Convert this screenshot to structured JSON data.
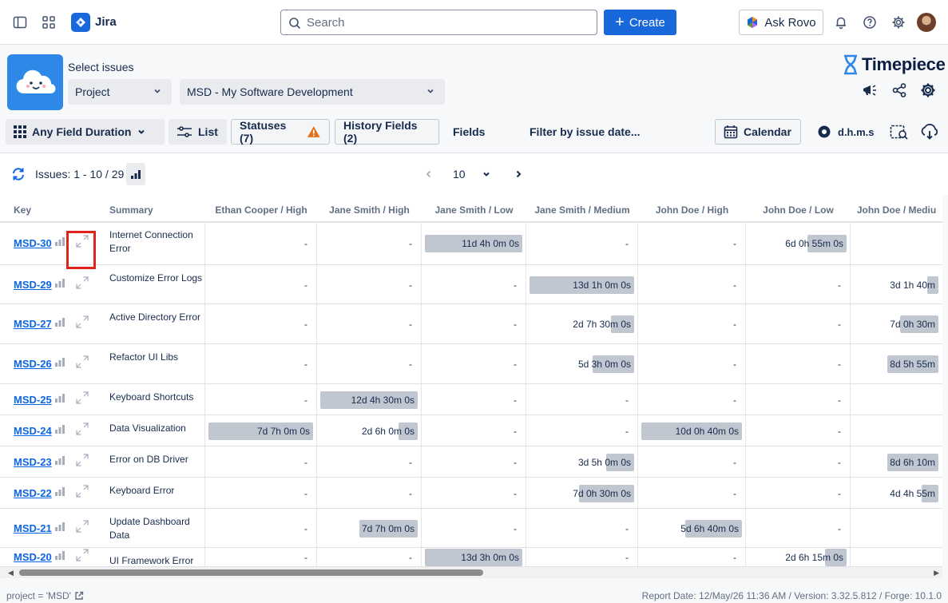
{
  "topbar": {
    "app_name": "Jira",
    "search_placeholder": "Search",
    "create_label": "Create",
    "rovo_label": "Ask Rovo"
  },
  "selector": {
    "label": "Select issues",
    "type_value": "Project",
    "project_value": "MSD - My Software Development"
  },
  "brand": {
    "name": "Timepiece"
  },
  "toolbar": {
    "report_type": "Any Field Duration",
    "list": "List",
    "statuses": "Statuses (7)",
    "history_fields": "History Fields (2)",
    "fields": "Fields",
    "filter_date": "Filter by issue date...",
    "calendar": "Calendar",
    "format": "d.h.m.s"
  },
  "pager": {
    "issues_label": "Issues: 1 - 10 / 29",
    "page_size": "10"
  },
  "table": {
    "headers": [
      "Key",
      "Summary",
      "Ethan Cooper / High",
      "Jane Smith / High",
      "Jane Smith / Low",
      "Jane Smith / Medium",
      "John Doe / High",
      "John Doe / Low",
      "John Doe / Mediu"
    ],
    "rows": [
      {
        "key": "MSD-30",
        "summary": "Internet Connection Error",
        "cells": [
          "-",
          "-",
          {
            "v": "11d 4h 0m 0s",
            "f": 1.0
          },
          "-",
          "-",
          {
            "v": "6d 0h 55m 0s",
            "f": 0.4
          },
          ""
        ]
      },
      {
        "key": "MSD-29",
        "summary": "Customize Error Logs",
        "cells": [
          "-",
          "-",
          "-",
          {
            "v": "13d 1h 0m 0s",
            "f": 1.0
          },
          "-",
          "-",
          {
            "v": "3d 1h 40m",
            "f": 0.13
          }
        ]
      },
      {
        "key": "MSD-27",
        "summary": "Active Directory Error",
        "cells": [
          "-",
          "-",
          "-",
          {
            "v": "2d 7h 30m 0s",
            "f": 0.22
          },
          "-",
          "-",
          {
            "v": "7d 0h 30m",
            "f": 0.45
          }
        ]
      },
      {
        "key": "MSD-26",
        "summary": "Refactor UI Libs",
        "cells": [
          "-",
          "-",
          "-",
          {
            "v": "5d 3h 0m 0s",
            "f": 0.4
          },
          "-",
          "-",
          {
            "v": "8d 5h 55m",
            "f": 0.6
          }
        ]
      },
      {
        "key": "MSD-25",
        "summary": "Keyboard Shortcuts",
        "cells": [
          "-",
          {
            "v": "12d 4h 30m 0s",
            "f": 1.0
          },
          "-",
          "-",
          "-",
          "-",
          ""
        ]
      },
      {
        "key": "MSD-24",
        "summary": "Data Visualization",
        "cells": [
          {
            "v": "7d 7h 0m 0s",
            "f": 1.0
          },
          {
            "v": "2d 6h 0m 0s",
            "f": 0.2
          },
          "-",
          "-",
          {
            "v": "10d 0h 40m 0s",
            "f": 1.0
          },
          "-",
          ""
        ]
      },
      {
        "key": "MSD-23",
        "summary": "Error on DB Driver",
        "cells": [
          "-",
          "-",
          "-",
          {
            "v": "3d 5h 0m 0s",
            "f": 0.27
          },
          "-",
          "-",
          {
            "v": "8d 6h 10m",
            "f": 0.6
          }
        ]
      },
      {
        "key": "MSD-22",
        "summary": "Keyboard Error",
        "cells": [
          "-",
          "-",
          "-",
          {
            "v": "7d 0h 30m 0s",
            "f": 0.53
          },
          "-",
          "-",
          {
            "v": "4d 4h 55m",
            "f": 0.2
          }
        ]
      },
      {
        "key": "MSD-21",
        "summary": "Update Dashboard Data",
        "cells": [
          "-",
          {
            "v": "7d 7h 0m 0s",
            "f": 0.6
          },
          "-",
          "-",
          {
            "v": "5d 6h 40m 0s",
            "f": 0.56
          },
          "-",
          ""
        ]
      },
      {
        "key": "MSD-20",
        "summary": "UI Framework Error",
        "cells": [
          "-",
          "-",
          {
            "v": "13d 3h 0m 0s",
            "f": 1.0
          },
          "-",
          "-",
          {
            "v": "2d 6h 15m 0s",
            "f": 0.22
          },
          ""
        ]
      }
    ]
  },
  "footer": {
    "query": "project = 'MSD'",
    "report_info": "Report Date: 12/May/26 11:36 AM / Version: 3.32.5.812 / Forge: 10.1.0"
  },
  "colors": {
    "accent": "#1868db",
    "bar_fill": "#c1c7d0",
    "warning": "#e2711d",
    "highlight_box": "#e2231a"
  }
}
